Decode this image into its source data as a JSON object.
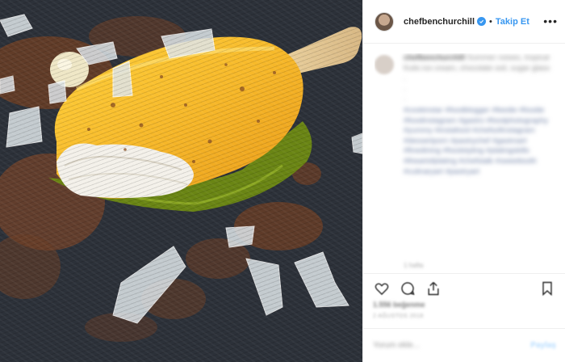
{
  "post": {
    "username": "chefbenchurchill",
    "verified": true,
    "follow_label": "Takip Et",
    "more_icon": "more-options-icon"
  },
  "caption": {
    "username": "chefbenchurchill",
    "text": "Summer noises, tropical fruits ice cream, chocolate soil, sugar glass",
    "lines": [
      ".",
      ".",
      "."
    ],
    "hashtags": "#cookinstar #foodblogger #feedie #foodie #foodinstagram #gastro #foodphotography #yummy #instafood #chefsofinstagram #dessertporn #pastrychef #gastroart #finedining #foodstyling #platingskills #theartofplating #chefstalk #sweettooth #culinaryart #pastryart"
  },
  "time_ago": "1 hafta",
  "likes": "1.556 beğenme",
  "date": "2 AĞUSTOS 2018",
  "add_comment_placeholder": "Yorum ekle...",
  "post_label": "Paylaş",
  "icons": {
    "like": "heart-icon",
    "comment": "comment-icon",
    "share": "share-icon",
    "save": "bookmark-icon"
  }
}
